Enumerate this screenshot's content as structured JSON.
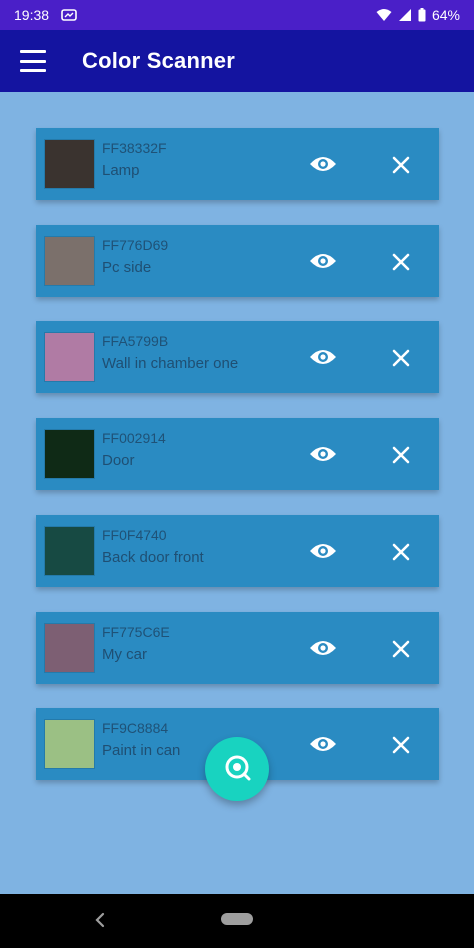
{
  "status_bar": {
    "time": "19:38",
    "battery": "64%"
  },
  "app_bar": {
    "title": "Color Scanner"
  },
  "colors": [
    {
      "hex": "FF38332F",
      "name": "Lamp",
      "swatch": "#3a332f"
    },
    {
      "hex": "FF776D69",
      "name": "Pc side",
      "swatch": "#7b706b"
    },
    {
      "hex": "FFA5799B",
      "name": "Wall in chamber one",
      "swatch": "#b07ba4"
    },
    {
      "hex": "FF002914",
      "name": "Door",
      "swatch": "#0f2a16"
    },
    {
      "hex": "FF0F4740",
      "name": "Back door front",
      "swatch": "#174a43"
    },
    {
      "hex": "FF775C6E",
      "name": "My car",
      "swatch": "#7d5f73"
    },
    {
      "hex": "FF9C8884",
      "name": "Paint in can",
      "swatch": "#9bc084"
    }
  ],
  "icons": {
    "menu": "menu-icon",
    "view": "eye-icon",
    "delete": "close-icon",
    "scan": "scan-icon"
  },
  "theme": {
    "status_bar": "#4a1fc8",
    "app_bar": "#1414a0",
    "background": "#7fb3e2",
    "card": "#2a8bc2",
    "fab": "#18d3c0"
  }
}
